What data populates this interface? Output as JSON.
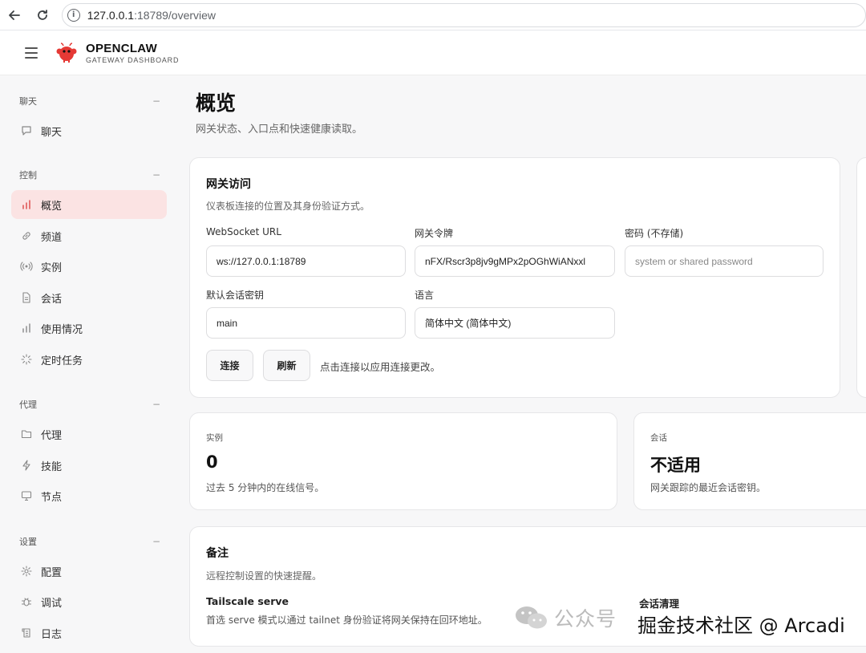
{
  "browser": {
    "url_host": "127.0.0.1",
    "url_path": ":18789/overview"
  },
  "header": {
    "brand_title": "OPENCLAW",
    "brand_subtitle": "GATEWAY DASHBOARD"
  },
  "sidebar": {
    "groups": [
      {
        "label": "聊天",
        "items": [
          {
            "label": "聊天",
            "icon": "message-icon"
          }
        ]
      },
      {
        "label": "控制",
        "items": [
          {
            "label": "概览",
            "icon": "bar-chart-icon",
            "active": true
          },
          {
            "label": "频道",
            "icon": "link-icon"
          },
          {
            "label": "实例",
            "icon": "radio-icon"
          },
          {
            "label": "会话",
            "icon": "document-icon"
          },
          {
            "label": "使用情况",
            "icon": "bar-chart-icon"
          },
          {
            "label": "定时任务",
            "icon": "loader-icon"
          }
        ]
      },
      {
        "label": "代理",
        "items": [
          {
            "label": "代理",
            "icon": "folder-icon"
          },
          {
            "label": "技能",
            "icon": "lightning-icon"
          },
          {
            "label": "节点",
            "icon": "monitor-icon"
          }
        ]
      },
      {
        "label": "设置",
        "items": [
          {
            "label": "配置",
            "icon": "gear-icon"
          },
          {
            "label": "调试",
            "icon": "bug-icon"
          },
          {
            "label": "日志",
            "icon": "scroll-icon"
          }
        ]
      }
    ]
  },
  "page": {
    "title": "概览",
    "subtitle": "网关状态、入口点和快速健康读取。"
  },
  "gateway_access": {
    "title": "网关访问",
    "description": "仪表板连接的位置及其身份验证方式。",
    "websocket_label": "WebSocket URL",
    "websocket_value": "ws://127.0.0.1:18789",
    "token_label": "网关令牌",
    "token_value": "nFX/Rscr3p8jv9gMPx2pOGhWiANxxl",
    "password_label": "密码 (不存储)",
    "password_placeholder": "system or shared password",
    "session_key_label": "默认会话密钥",
    "session_key_value": "main",
    "language_label": "语言",
    "language_value": "简体中文 (简体中文)",
    "connect_button": "连接",
    "refresh_button": "刷新",
    "hint": "点击连接以应用连接更改。"
  },
  "stats": {
    "instances": {
      "label": "实例",
      "value": "0",
      "description": "过去 5 分钟内的在线信号。"
    },
    "sessions": {
      "label": "会话",
      "value": "不适用",
      "description": "网关跟踪的最近会话密钥。"
    }
  },
  "notes": {
    "title": "备注",
    "description": "远程控制设置的快速提醒。",
    "tailscale_title": "Tailscale serve",
    "tailscale_text": "首选 serve 模式以通过 tailnet 身份验证将网关保持在回环地址。",
    "session_cleanup_title": "会话清理"
  },
  "watermarks": {
    "wechat": "公众号",
    "juejin": "掘金技术社区 @ Arcadi"
  },
  "colors": {
    "accent": "#e05a5a",
    "active_bg": "#fbe3e3",
    "sidebar_bg": "#f7f7f8"
  }
}
